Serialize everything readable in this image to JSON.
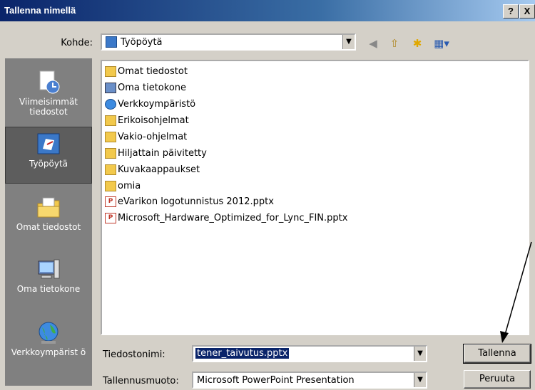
{
  "window": {
    "title": "Tallenna nimellä",
    "help": "?",
    "close": "X"
  },
  "toolbar": {
    "lookin_label": "Kohde:",
    "lookin_value": "Työpöytä"
  },
  "places": [
    {
      "label": "Viimeisimmät tiedostot"
    },
    {
      "label": "Työpöytä"
    },
    {
      "label": "Omat tiedostot"
    },
    {
      "label": "Oma tietokone"
    },
    {
      "label": "Verkkoympärist ö"
    }
  ],
  "files": [
    {
      "name": "Omat tiedostot",
      "icon": "documents-folder-icon"
    },
    {
      "name": "Oma tietokone",
      "icon": "computer-icon"
    },
    {
      "name": "Verkkoympäristö",
      "icon": "network-icon"
    },
    {
      "name": "Erikoisohjelmat",
      "icon": "folder-icon"
    },
    {
      "name": "Vakio-ohjelmat",
      "icon": "folder-icon"
    },
    {
      "name": "Hiljattain päivitetty",
      "icon": "folder-icon"
    },
    {
      "name": "Kuvakaappaukset",
      "icon": "folder-icon"
    },
    {
      "name": "omia",
      "icon": "folder-icon"
    },
    {
      "name": "eVarikon logotunnistus 2012.pptx",
      "icon": "pptx-file-icon"
    },
    {
      "name": "Microsoft_Hardware_Optimized_for_Lync_FIN.pptx",
      "icon": "pptx-file-icon"
    }
  ],
  "filename": {
    "label": "Tiedostonimi:",
    "value": "tener_taivutus.pptx"
  },
  "filetype": {
    "label": "Tallennusmuoto:",
    "value": "Microsoft PowerPoint Presentation"
  },
  "buttons": {
    "save": "Tallenna",
    "cancel": "Peruuta"
  },
  "colors": {
    "titlebar": "#0a246a",
    "selection": "#0a246a",
    "places_bg": "#808080"
  }
}
